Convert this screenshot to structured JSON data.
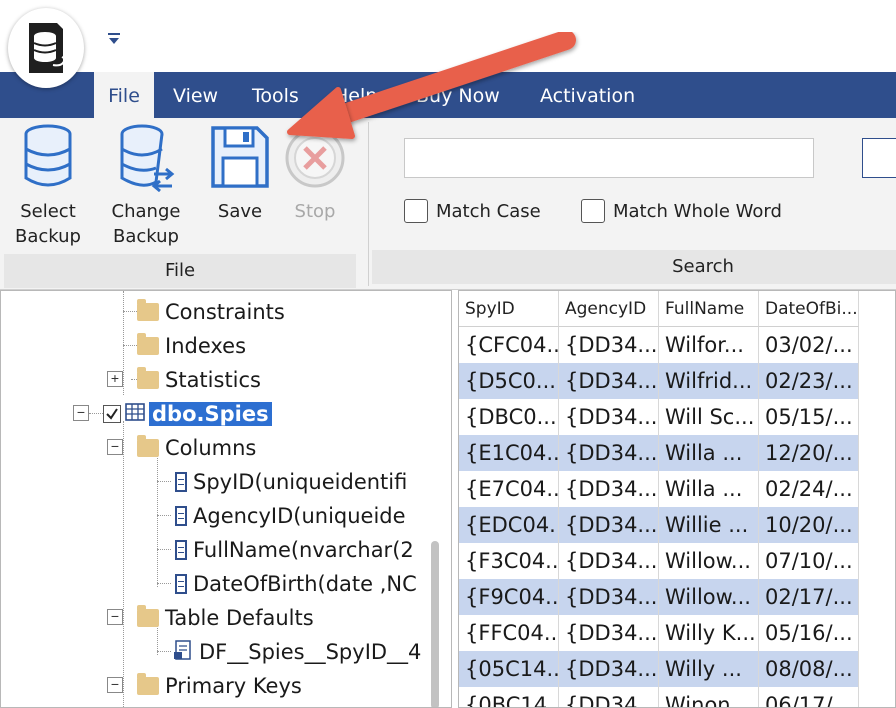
{
  "menu": {
    "tabs": [
      {
        "label": "File",
        "active": true
      },
      {
        "label": "View",
        "active": false
      },
      {
        "label": "Tools",
        "active": false
      },
      {
        "label": "Help",
        "active": false
      },
      {
        "label": "Buy Now",
        "active": false
      },
      {
        "label": "Activation",
        "active": false
      }
    ]
  },
  "ribbon": {
    "file_group": {
      "label": "File",
      "select_backup": [
        "Select",
        "Backup"
      ],
      "change_backup_set": [
        "Change",
        "Backup Set"
      ],
      "save": "Save",
      "stop": "Stop"
    },
    "search_group": {
      "label": "Search",
      "search_value": "",
      "match_case": "Match Case",
      "match_whole_word": "Match Whole Word"
    }
  },
  "tree": {
    "nodes": [
      {
        "label": "Constraints",
        "type": "folder"
      },
      {
        "label": "Indexes",
        "type": "folder"
      },
      {
        "label": "Statistics",
        "type": "folder",
        "expander": "+"
      },
      {
        "label": "dbo.Spies",
        "type": "table",
        "expander": "−",
        "checked": true,
        "selected": true
      },
      {
        "label": "Columns",
        "type": "folder",
        "expander": "−"
      },
      {
        "label": "SpyID(uniqueidentifi",
        "type": "column"
      },
      {
        "label": "AgencyID(uniqueide",
        "type": "column"
      },
      {
        "label": "FullName(nvarchar(2",
        "type": "column"
      },
      {
        "label": "DateOfBirth(date ,NC",
        "type": "column"
      },
      {
        "label": "Table Defaults",
        "type": "folder",
        "expander": "−"
      },
      {
        "label": "DF__Spies__SpyID__4",
        "type": "default"
      },
      {
        "label": "Primary Keys",
        "type": "folder",
        "expander": "−"
      }
    ]
  },
  "grid": {
    "columns": [
      "SpyID",
      "AgencyID",
      "FullName",
      "DateOfBi..."
    ],
    "rows": [
      [
        "{CFC04...",
        "{DD34...",
        "Wilfor...",
        "03/02/..."
      ],
      [
        "{D5C0...",
        "{DD34...",
        "Wilfrid...",
        "02/23/..."
      ],
      [
        "{DBC0...",
        "{DD34...",
        "Will Sc...",
        "05/15/..."
      ],
      [
        "{E1C04...",
        "{DD34...",
        "Willa ...",
        "12/20/..."
      ],
      [
        "{E7C04...",
        "{DD34...",
        "Willa ...",
        "02/24/..."
      ],
      [
        "{EDC04...",
        "{DD34...",
        "Willie ...",
        "10/20/..."
      ],
      [
        "{F3C04...",
        "{DD34...",
        "Willow...",
        "07/10/..."
      ],
      [
        "{F9C04...",
        "{DD34...",
        "Willow...",
        "02/17/..."
      ],
      [
        "{FFC04...",
        "{DD34...",
        "Willy K...",
        "05/16/..."
      ],
      [
        "{05C14...",
        "{DD34...",
        "Willy ...",
        "08/08/..."
      ],
      [
        "{0BC14...",
        "{DD34...",
        "Winon...",
        "06/17/..."
      ]
    ]
  },
  "colors": {
    "menubar": "#2f4e8c",
    "selection": "#2d6fd1",
    "alt_row": "#c7d5ee",
    "annotation_arrow": "#e8604c"
  }
}
